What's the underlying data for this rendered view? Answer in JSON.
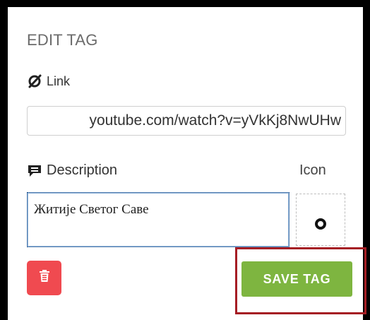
{
  "panel": {
    "title": "EDIT TAG"
  },
  "link": {
    "label": "Link",
    "icon": "link-broken-icon",
    "value": "youtube.com/watch?v=yVkKj8NwUHw"
  },
  "description": {
    "label": "Description",
    "icon": "comment-icon",
    "value": "Житије Светог Саве"
  },
  "icon_field": {
    "label": "Icon",
    "selected_icon": "circle-outline-icon"
  },
  "actions": {
    "delete_icon": "trash-icon",
    "save_label": "SAVE TAG"
  },
  "colors": {
    "delete": "#f04a50",
    "save": "#7eb540",
    "highlight": "#a51d24"
  }
}
